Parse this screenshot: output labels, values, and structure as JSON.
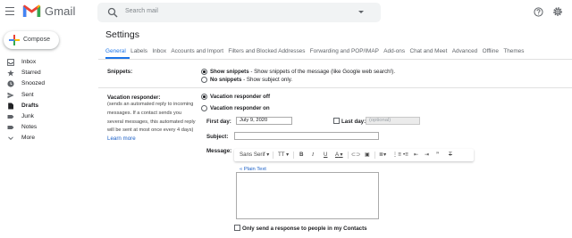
{
  "app": {
    "logo_text": "Gmail",
    "accent": "#1a73e8"
  },
  "search": {
    "placeholder": "Search mail"
  },
  "compose": {
    "label": "Compose"
  },
  "sidebar": {
    "items": [
      {
        "label": "Inbox",
        "icon": "inbox-icon",
        "bold": false
      },
      {
        "label": "Starred",
        "icon": "star-icon",
        "bold": false
      },
      {
        "label": "Snoozed",
        "icon": "clock-icon",
        "bold": false
      },
      {
        "label": "Sent",
        "icon": "send-icon",
        "bold": false
      },
      {
        "label": "Drafts",
        "icon": "draft-icon",
        "bold": true
      },
      {
        "label": "Junk",
        "icon": "label-icon",
        "bold": false
      },
      {
        "label": "Notes",
        "icon": "label-icon",
        "bold": false
      },
      {
        "label": "More",
        "icon": "chevron-down-icon",
        "bold": false
      }
    ]
  },
  "settings": {
    "title": "Settings",
    "tabs": [
      {
        "label": "General",
        "active": true
      },
      {
        "label": "Labels"
      },
      {
        "label": "Inbox"
      },
      {
        "label": "Accounts and Import"
      },
      {
        "label": "Filters and Blocked Addresses"
      },
      {
        "label": "Forwarding and POP/IMAP"
      },
      {
        "label": "Add-ons"
      },
      {
        "label": "Chat and Meet"
      },
      {
        "label": "Advanced"
      },
      {
        "label": "Offline"
      },
      {
        "label": "Themes"
      }
    ],
    "snippets": {
      "label": "Snippets:",
      "show_bold": "Show snippets",
      "show_rest": " - Show snippets of the message (like Google web search!).",
      "none_bold": "No snippets",
      "none_rest": " - Show subject only.",
      "selected": "show"
    },
    "vacation": {
      "label": "Vacation responder:",
      "desc": [
        "(sends an automated reply to incoming",
        "messages. If a contact sends you",
        "several messages, this automated reply",
        "will be sent at most once every 4 days)"
      ],
      "learn_more": "Learn more",
      "off_label": "Vacation responder off",
      "on_label": "Vacation responder on",
      "selected": "off",
      "first_day_label": "First day:",
      "first_day_value": "July 9, 2020",
      "last_day_label": "Last day:",
      "last_day_placeholder": "(optional)",
      "subject_label": "Subject:",
      "subject_value": "",
      "message_label": "Message:",
      "toolbar": {
        "font": "Sans Serif",
        "font_size": "T",
        "bold": "B",
        "italic": "I",
        "underline": "U",
        "text_color": "A"
      },
      "plain_text_link": "« Plain Text",
      "contacts_only": "Only send a response to people in my Contacts"
    }
  }
}
